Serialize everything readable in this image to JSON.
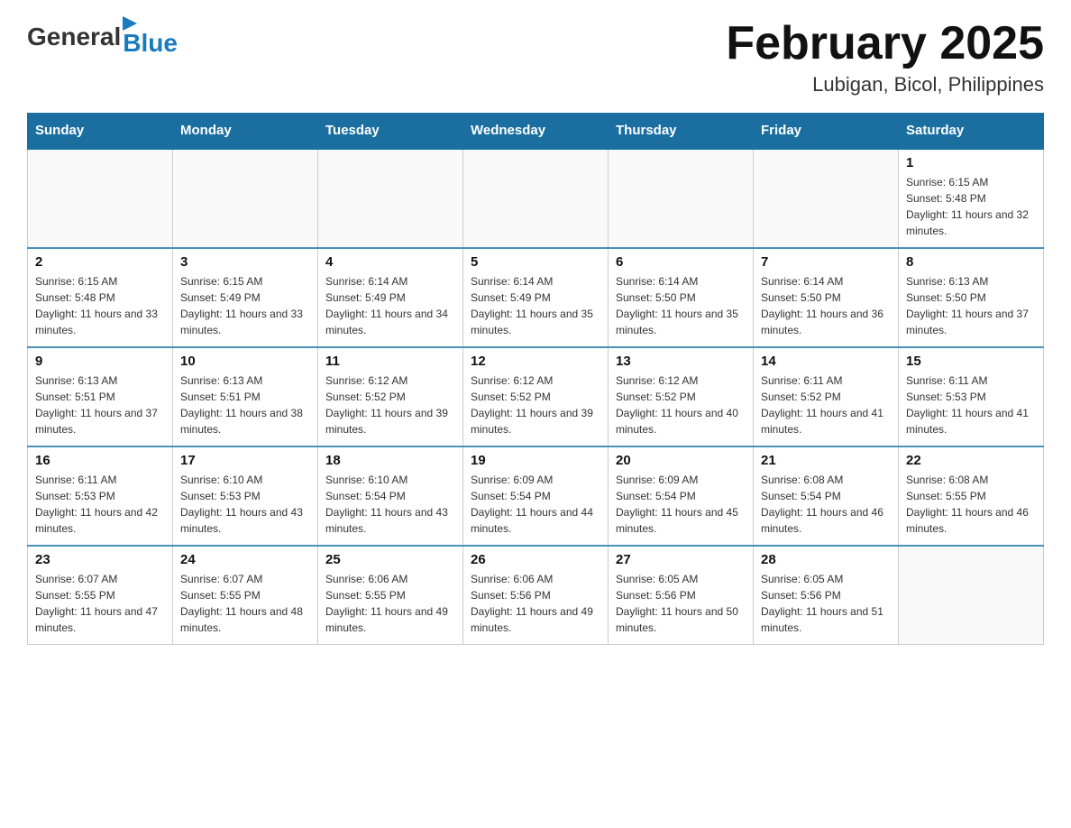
{
  "logo": {
    "general": "General",
    "blue": "Blue",
    "arrow": "▶"
  },
  "calendar": {
    "title": "February 2025",
    "subtitle": "Lubigan, Bicol, Philippines",
    "days_of_week": [
      "Sunday",
      "Monday",
      "Tuesday",
      "Wednesday",
      "Thursday",
      "Friday",
      "Saturday"
    ],
    "weeks": [
      {
        "days": [
          {
            "num": "",
            "sunrise": "",
            "sunset": "",
            "daylight": "",
            "empty": true
          },
          {
            "num": "",
            "sunrise": "",
            "sunset": "",
            "daylight": "",
            "empty": true
          },
          {
            "num": "",
            "sunrise": "",
            "sunset": "",
            "daylight": "",
            "empty": true
          },
          {
            "num": "",
            "sunrise": "",
            "sunset": "",
            "daylight": "",
            "empty": true
          },
          {
            "num": "",
            "sunrise": "",
            "sunset": "",
            "daylight": "",
            "empty": true
          },
          {
            "num": "",
            "sunrise": "",
            "sunset": "",
            "daylight": "",
            "empty": true
          },
          {
            "num": "1",
            "sunrise": "Sunrise: 6:15 AM",
            "sunset": "Sunset: 5:48 PM",
            "daylight": "Daylight: 11 hours and 32 minutes.",
            "empty": false
          }
        ]
      },
      {
        "days": [
          {
            "num": "2",
            "sunrise": "Sunrise: 6:15 AM",
            "sunset": "Sunset: 5:48 PM",
            "daylight": "Daylight: 11 hours and 33 minutes.",
            "empty": false
          },
          {
            "num": "3",
            "sunrise": "Sunrise: 6:15 AM",
            "sunset": "Sunset: 5:49 PM",
            "daylight": "Daylight: 11 hours and 33 minutes.",
            "empty": false
          },
          {
            "num": "4",
            "sunrise": "Sunrise: 6:14 AM",
            "sunset": "Sunset: 5:49 PM",
            "daylight": "Daylight: 11 hours and 34 minutes.",
            "empty": false
          },
          {
            "num": "5",
            "sunrise": "Sunrise: 6:14 AM",
            "sunset": "Sunset: 5:49 PM",
            "daylight": "Daylight: 11 hours and 35 minutes.",
            "empty": false
          },
          {
            "num": "6",
            "sunrise": "Sunrise: 6:14 AM",
            "sunset": "Sunset: 5:50 PM",
            "daylight": "Daylight: 11 hours and 35 minutes.",
            "empty": false
          },
          {
            "num": "7",
            "sunrise": "Sunrise: 6:14 AM",
            "sunset": "Sunset: 5:50 PM",
            "daylight": "Daylight: 11 hours and 36 minutes.",
            "empty": false
          },
          {
            "num": "8",
            "sunrise": "Sunrise: 6:13 AM",
            "sunset": "Sunset: 5:50 PM",
            "daylight": "Daylight: 11 hours and 37 minutes.",
            "empty": false
          }
        ]
      },
      {
        "days": [
          {
            "num": "9",
            "sunrise": "Sunrise: 6:13 AM",
            "sunset": "Sunset: 5:51 PM",
            "daylight": "Daylight: 11 hours and 37 minutes.",
            "empty": false
          },
          {
            "num": "10",
            "sunrise": "Sunrise: 6:13 AM",
            "sunset": "Sunset: 5:51 PM",
            "daylight": "Daylight: 11 hours and 38 minutes.",
            "empty": false
          },
          {
            "num": "11",
            "sunrise": "Sunrise: 6:12 AM",
            "sunset": "Sunset: 5:52 PM",
            "daylight": "Daylight: 11 hours and 39 minutes.",
            "empty": false
          },
          {
            "num": "12",
            "sunrise": "Sunrise: 6:12 AM",
            "sunset": "Sunset: 5:52 PM",
            "daylight": "Daylight: 11 hours and 39 minutes.",
            "empty": false
          },
          {
            "num": "13",
            "sunrise": "Sunrise: 6:12 AM",
            "sunset": "Sunset: 5:52 PM",
            "daylight": "Daylight: 11 hours and 40 minutes.",
            "empty": false
          },
          {
            "num": "14",
            "sunrise": "Sunrise: 6:11 AM",
            "sunset": "Sunset: 5:52 PM",
            "daylight": "Daylight: 11 hours and 41 minutes.",
            "empty": false
          },
          {
            "num": "15",
            "sunrise": "Sunrise: 6:11 AM",
            "sunset": "Sunset: 5:53 PM",
            "daylight": "Daylight: 11 hours and 41 minutes.",
            "empty": false
          }
        ]
      },
      {
        "days": [
          {
            "num": "16",
            "sunrise": "Sunrise: 6:11 AM",
            "sunset": "Sunset: 5:53 PM",
            "daylight": "Daylight: 11 hours and 42 minutes.",
            "empty": false
          },
          {
            "num": "17",
            "sunrise": "Sunrise: 6:10 AM",
            "sunset": "Sunset: 5:53 PM",
            "daylight": "Daylight: 11 hours and 43 minutes.",
            "empty": false
          },
          {
            "num": "18",
            "sunrise": "Sunrise: 6:10 AM",
            "sunset": "Sunset: 5:54 PM",
            "daylight": "Daylight: 11 hours and 43 minutes.",
            "empty": false
          },
          {
            "num": "19",
            "sunrise": "Sunrise: 6:09 AM",
            "sunset": "Sunset: 5:54 PM",
            "daylight": "Daylight: 11 hours and 44 minutes.",
            "empty": false
          },
          {
            "num": "20",
            "sunrise": "Sunrise: 6:09 AM",
            "sunset": "Sunset: 5:54 PM",
            "daylight": "Daylight: 11 hours and 45 minutes.",
            "empty": false
          },
          {
            "num": "21",
            "sunrise": "Sunrise: 6:08 AM",
            "sunset": "Sunset: 5:54 PM",
            "daylight": "Daylight: 11 hours and 46 minutes.",
            "empty": false
          },
          {
            "num": "22",
            "sunrise": "Sunrise: 6:08 AM",
            "sunset": "Sunset: 5:55 PM",
            "daylight": "Daylight: 11 hours and 46 minutes.",
            "empty": false
          }
        ]
      },
      {
        "days": [
          {
            "num": "23",
            "sunrise": "Sunrise: 6:07 AM",
            "sunset": "Sunset: 5:55 PM",
            "daylight": "Daylight: 11 hours and 47 minutes.",
            "empty": false
          },
          {
            "num": "24",
            "sunrise": "Sunrise: 6:07 AM",
            "sunset": "Sunset: 5:55 PM",
            "daylight": "Daylight: 11 hours and 48 minutes.",
            "empty": false
          },
          {
            "num": "25",
            "sunrise": "Sunrise: 6:06 AM",
            "sunset": "Sunset: 5:55 PM",
            "daylight": "Daylight: 11 hours and 49 minutes.",
            "empty": false
          },
          {
            "num": "26",
            "sunrise": "Sunrise: 6:06 AM",
            "sunset": "Sunset: 5:56 PM",
            "daylight": "Daylight: 11 hours and 49 minutes.",
            "empty": false
          },
          {
            "num": "27",
            "sunrise": "Sunrise: 6:05 AM",
            "sunset": "Sunset: 5:56 PM",
            "daylight": "Daylight: 11 hours and 50 minutes.",
            "empty": false
          },
          {
            "num": "28",
            "sunrise": "Sunrise: 6:05 AM",
            "sunset": "Sunset: 5:56 PM",
            "daylight": "Daylight: 11 hours and 51 minutes.",
            "empty": false
          },
          {
            "num": "",
            "sunrise": "",
            "sunset": "",
            "daylight": "",
            "empty": true
          }
        ]
      }
    ]
  }
}
